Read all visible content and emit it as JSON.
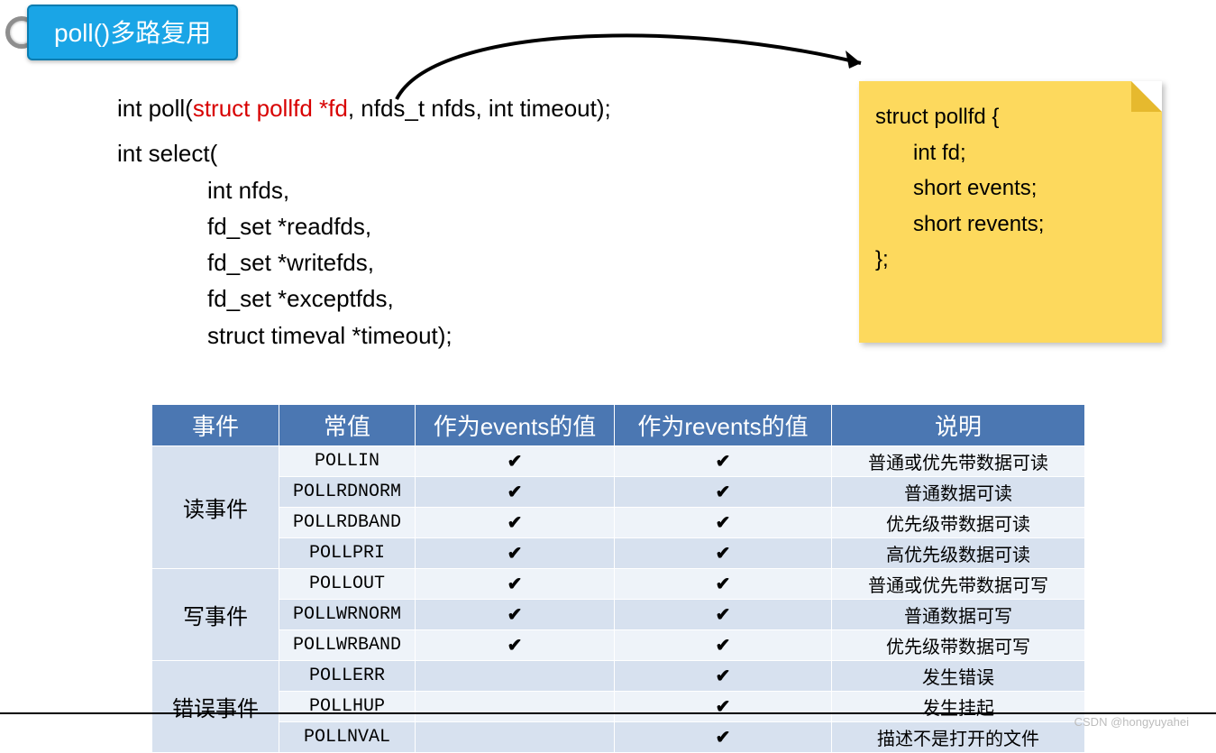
{
  "title": "poll()多路复用",
  "signatures": {
    "poll_prefix": "int poll(",
    "poll_red": "struct pollfd *fd",
    "poll_suffix": ", nfds_t nfds, int timeout);",
    "select_head": "int select(",
    "select_args": [
      "int nfds,",
      "fd_set *readfds,",
      "fd_set *writefds,",
      "fd_set *exceptfds,",
      "struct timeval *timeout);"
    ]
  },
  "struct": {
    "l1": "struct pollfd {",
    "l2": "int   fd;",
    "l3": "short events;",
    "l4": "short revents;",
    "l5": "};"
  },
  "table": {
    "headers": [
      "事件",
      "常值",
      "作为events的值",
      "作为revents的值",
      "说明"
    ],
    "groups": [
      {
        "label": "读事件",
        "rows": [
          {
            "const": "POLLIN",
            "ev": true,
            "rev": true,
            "desc": "普通或优先带数据可读"
          },
          {
            "const": "POLLRDNORM",
            "ev": true,
            "rev": true,
            "desc": "普通数据可读"
          },
          {
            "const": "POLLRDBAND",
            "ev": true,
            "rev": true,
            "desc": "优先级带数据可读"
          },
          {
            "const": "POLLPRI",
            "ev": true,
            "rev": true,
            "desc": "高优先级数据可读"
          }
        ]
      },
      {
        "label": "写事件",
        "rows": [
          {
            "const": "POLLOUT",
            "ev": true,
            "rev": true,
            "desc": "普通或优先带数据可写"
          },
          {
            "const": "POLLWRNORM",
            "ev": true,
            "rev": true,
            "desc": "普通数据可写"
          },
          {
            "const": "POLLWRBAND",
            "ev": true,
            "rev": true,
            "desc": "优先级带数据可写"
          }
        ]
      },
      {
        "label": "错误事件",
        "rows": [
          {
            "const": "POLLERR",
            "ev": false,
            "rev": true,
            "desc": "发生错误"
          },
          {
            "const": "POLLHUP",
            "ev": false,
            "rev": true,
            "desc": "发生挂起"
          },
          {
            "const": "POLLNVAL",
            "ev": false,
            "rev": true,
            "desc": "描述不是打开的文件"
          }
        ]
      }
    ]
  },
  "watermark": "CSDN @hongyuyahei",
  "tick": "✔"
}
